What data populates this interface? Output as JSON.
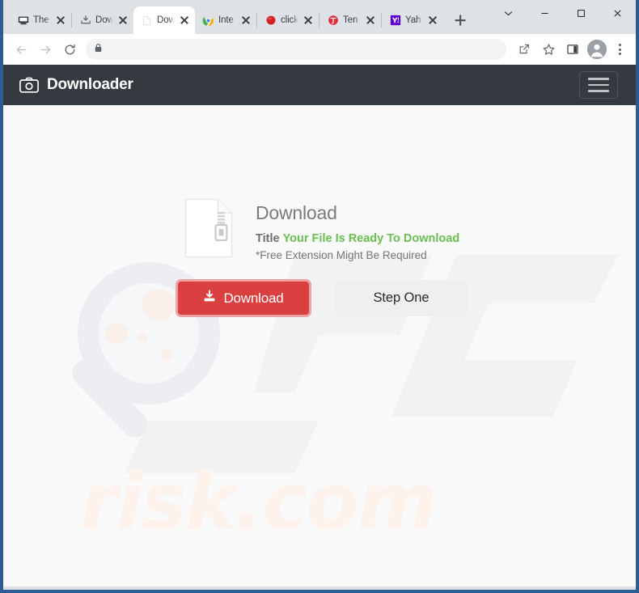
{
  "browser": {
    "tabs": [
      {
        "title": "The",
        "favicon": "computer-icon",
        "active": false
      },
      {
        "title": "Dow",
        "favicon": "download-tray-icon",
        "active": false
      },
      {
        "title": "Dow",
        "favicon": "blank-page-icon",
        "active": true
      },
      {
        "title": "Inte",
        "favicon": "chrome-icon",
        "active": false
      },
      {
        "title": "click",
        "favicon": "red-sphere-icon",
        "active": false
      },
      {
        "title": "Ten",
        "favicon": "red-t-icon",
        "active": false
      },
      {
        "title": "Yah",
        "favicon": "yahoo-icon",
        "active": false
      }
    ],
    "new_tab_label": "+",
    "window_controls": {
      "tab_search": "tab-search-chevron",
      "minimize": "minimize",
      "maximize": "maximize",
      "close": "close"
    },
    "toolbar": {
      "back": "back-arrow",
      "forward": "forward-arrow",
      "reload": "reload",
      "lock": "lock-icon",
      "url_value": "",
      "url_placeholder": "",
      "share": "share-icon",
      "bookmark": "star-icon",
      "side_panel": "side-panel-icon",
      "profile": "profile-avatar",
      "menu": "three-dot-menu"
    }
  },
  "page": {
    "header": {
      "brand_icon": "camera-icon",
      "brand_title": "Downloader",
      "menu_button": "hamburger-menu"
    },
    "card": {
      "file_icon": "zip-file-icon",
      "heading": "Download",
      "title_label": "Title",
      "title_value": "Your File Is Ready To Download",
      "note": "*Free Extension Might Be Required"
    },
    "buttons": {
      "download_icon": "download-icon",
      "download_label": "Download",
      "step_label": "Step One"
    },
    "watermarks": {
      "magnifier": "magnifying-glass-watermark",
      "brand_mark": "pc-letters-watermark",
      "domain_text": "risk.com"
    },
    "colors": {
      "header_bg": "#343a40",
      "download_btn": "#d9403f",
      "download_btn_border": "#eda3a3",
      "title_green": "#6abf52",
      "step_btn_bg": "#efefef",
      "page_bg": "#f9f9f9",
      "window_border": "#2c5c91",
      "watermark": "#fdf3ec"
    }
  }
}
